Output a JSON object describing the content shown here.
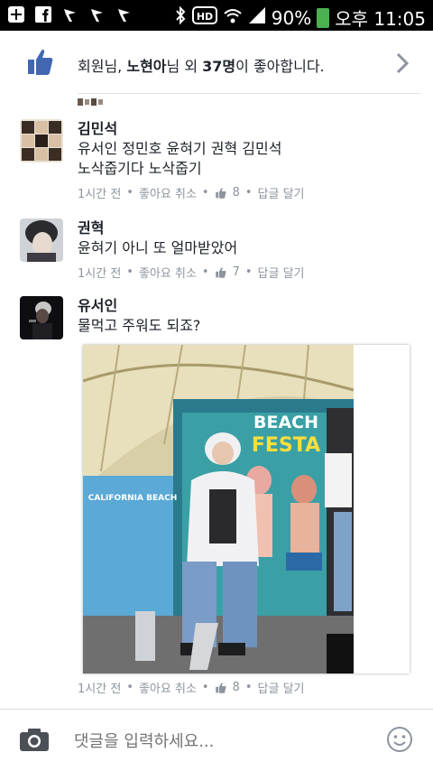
{
  "status_bar": {
    "battery": "90%",
    "time": "오후 11:05",
    "icons": [
      "plus-box-icon",
      "facebook-icon",
      "flag-icon",
      "flag-icon",
      "flag-icon",
      "bluetooth-icon",
      "hd-icon",
      "wifi-icon",
      "signal-icon",
      "battery-icon"
    ]
  },
  "likes": {
    "text_prefix": "회원님, ",
    "name": "노현아",
    "text_mid": "님 외 ",
    "count": "37명",
    "text_suffix": "이 좋아합니다."
  },
  "comments": [
    {
      "name": "김민석",
      "text": "유서인 정민호 윤혀기 권혁 김민석\n노삭줍기다 노삭줍기",
      "time": "1시간 전",
      "unlike": "좋아요 취소",
      "likes": "8",
      "reply": "답글 달기"
    },
    {
      "name": "권혁",
      "text": "윤혀기 아니 또 얼마받았어",
      "time": "1시간 전",
      "unlike": "좋아요 취소",
      "likes": "7",
      "reply": "답글 달기"
    },
    {
      "name": "유서인",
      "text": "물먹고 주워도 되죠?",
      "time": "1시간 전",
      "unlike": "좋아요 취소",
      "likes": "8",
      "reply": "답글 달기",
      "photo": {
        "sign_line1": "BEACH",
        "sign_line2": "FESTA",
        "sign_left": "CALIFORNIA BEACH"
      }
    }
  ],
  "composer": {
    "placeholder": "댓글을 입력하세요..."
  },
  "colors": {
    "facebook_blue": "#4267b2",
    "meta_gray": "#8d949e"
  }
}
